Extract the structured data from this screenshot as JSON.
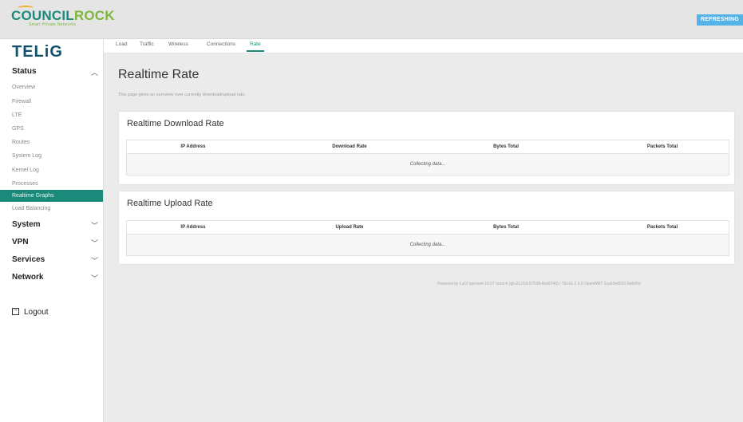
{
  "header": {
    "logo_part1": "COUNCIL",
    "logo_part2": "ROCK",
    "logo_tagline": "Smart Private Networks",
    "refresh_label": "REFRESHING"
  },
  "sidebar": {
    "brand": "TELiG",
    "status_label": "Status",
    "status_items": [
      "Overview",
      "Firewall",
      "LTE",
      "GPS",
      "Routes",
      "System Log",
      "Kernel Log",
      "Processes",
      "Realtime Graphs",
      "Load Balancing"
    ],
    "active_item": "Realtime Graphs",
    "system_label": "System",
    "vpn_label": "VPN",
    "services_label": "Services",
    "network_label": "Network",
    "logout_label": "Logout"
  },
  "tabs": [
    "Load",
    "Traffic",
    "Wireless",
    "Connections",
    "Rate"
  ],
  "active_tab": "Rate",
  "main": {
    "title": "Realtime Rate",
    "description": "This page gives an overview over currently download/upload rate."
  },
  "download": {
    "title": "Realtime Download Rate",
    "columns": [
      "IP Address",
      "Download Rate",
      "Bytes Total",
      "Packets Total"
    ],
    "status": "Collecting data..."
  },
  "upload": {
    "title": "Realtime Upload Rate",
    "columns": [
      "IP Address",
      "Upload Rate",
      "Bytes Total",
      "Packets Total"
    ],
    "status": "Collecting data..."
  },
  "footer": "Powered by LuCI openwrt-19.07 branch (git-21.018.57538-6ba9740) / TELiG 2.5.0 OpenWRT 1ca63e8923-5eb06d"
}
